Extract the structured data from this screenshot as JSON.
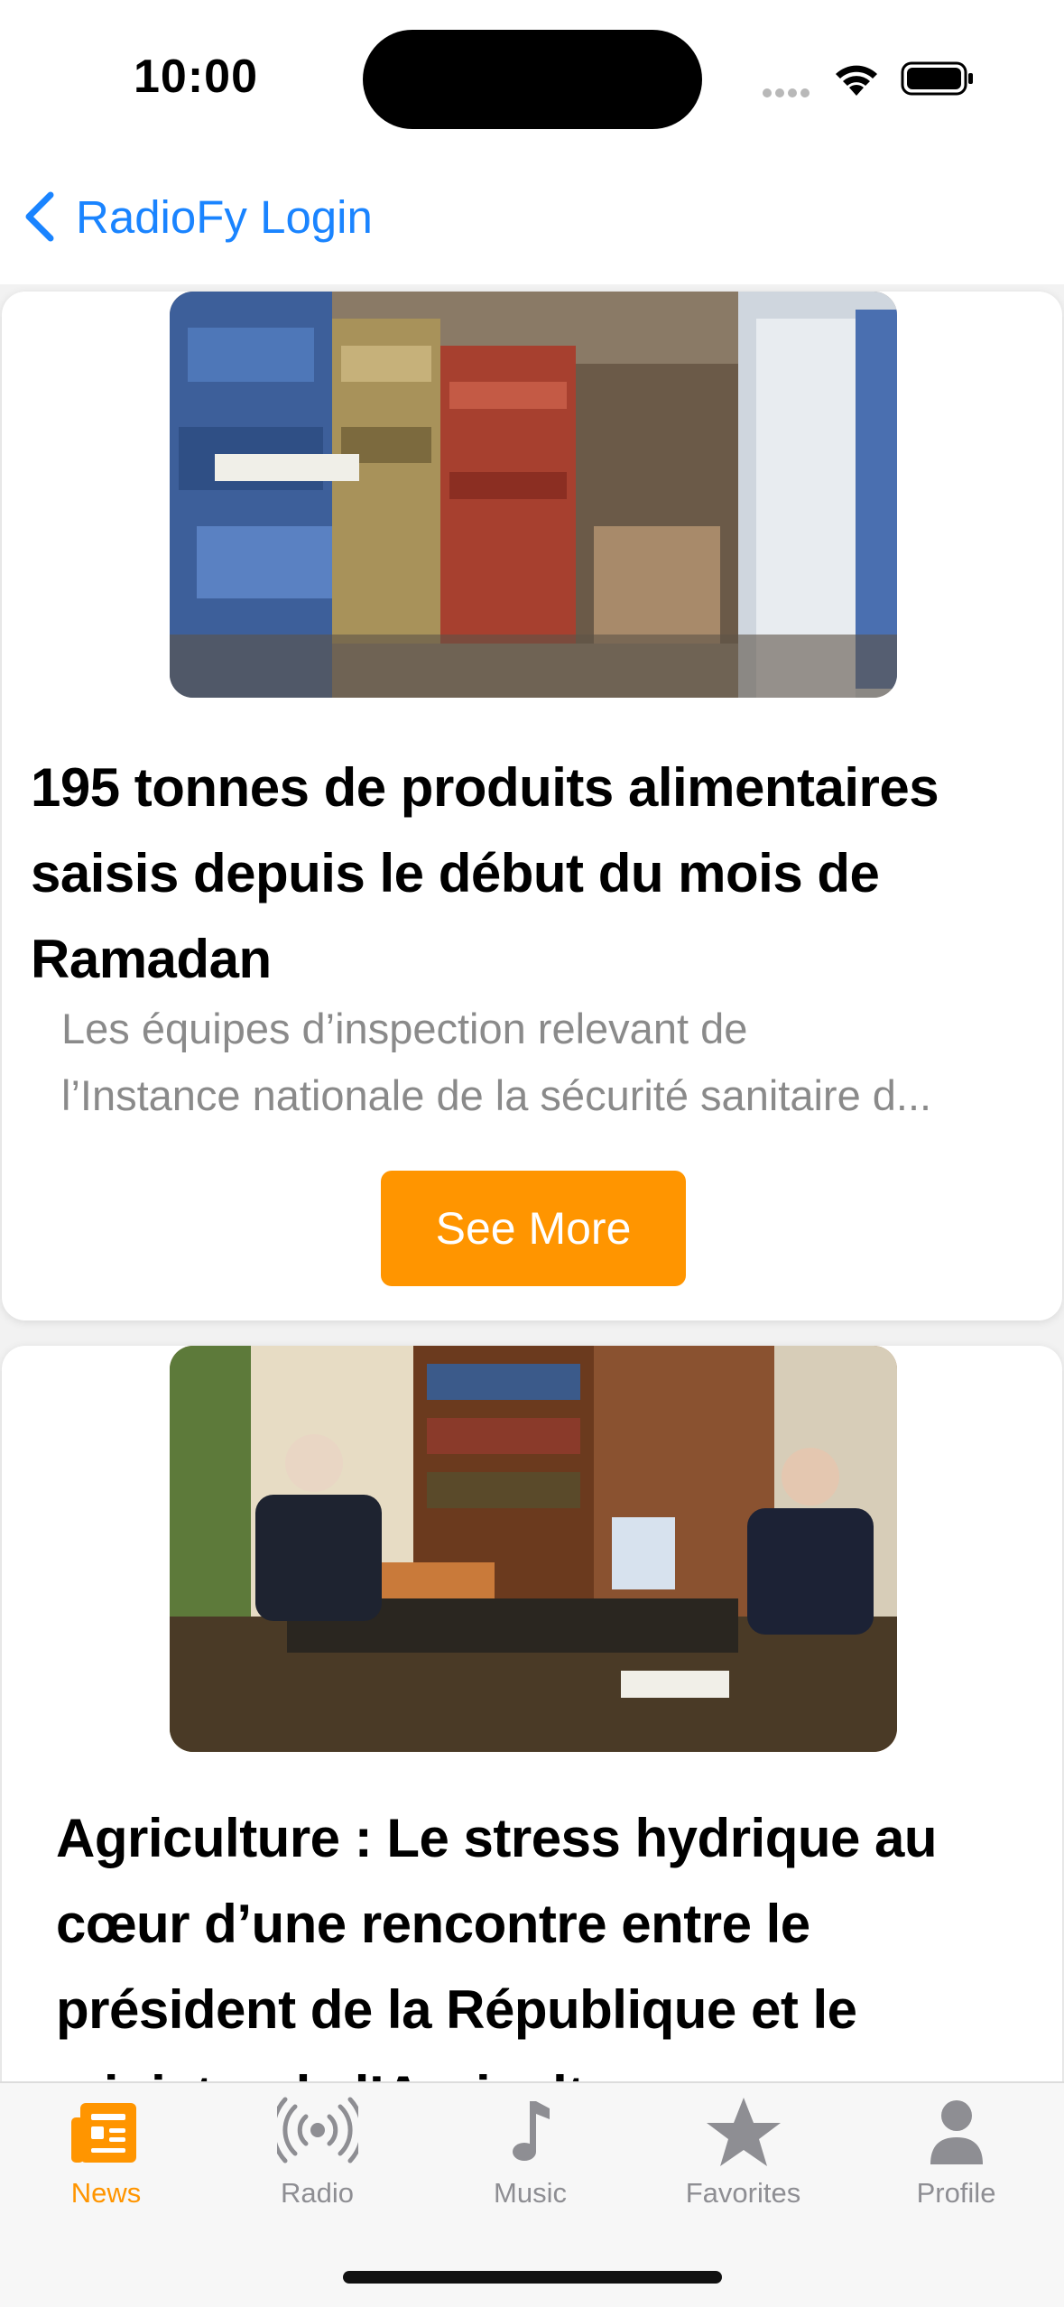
{
  "status_bar": {
    "time": "10:00"
  },
  "nav": {
    "back_label": "RadioFy Login"
  },
  "feed": {
    "articles": [
      {
        "title": "195 tonnes de produits alimentaires saisis depuis le début du mois de Ramadan",
        "excerpt_line1": "Les équipes d’inspection relevant de",
        "excerpt_line2": "l’Instance nationale de la sécurité sanitaire d...",
        "button_label": "See More"
      },
      {
        "title": "Agriculture : Le stress hydrique au cœur d’une rencontre entre le président de la République et le ministre de l’Agriculture"
      }
    ]
  },
  "tab_bar": {
    "tabs": [
      {
        "label": "News",
        "icon": "newspaper-icon",
        "active": true
      },
      {
        "label": "Radio",
        "icon": "radio-waves-icon",
        "active": false
      },
      {
        "label": "Music",
        "icon": "music-note-icon",
        "active": false
      },
      {
        "label": "Favorites",
        "icon": "star-icon",
        "active": false
      },
      {
        "label": "Profile",
        "icon": "person-icon",
        "active": false
      }
    ]
  },
  "colors": {
    "accent": "#ff9500",
    "link": "#1a84ff",
    "inactive": "#8e8e93",
    "secondary_text": "#8a8a8a"
  }
}
